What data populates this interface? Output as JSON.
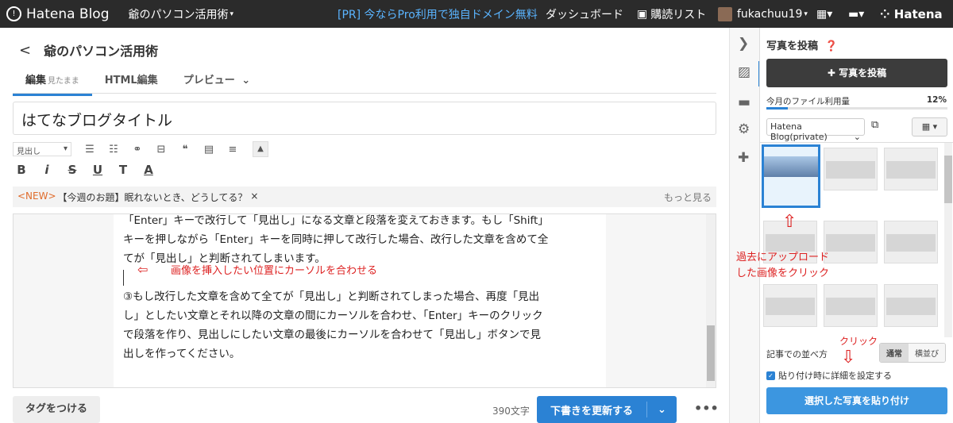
{
  "topbar": {
    "logo_text": "Hatena Blog",
    "blog_name": "爺のパソコン活用術",
    "pr_text": "[PR] 今ならPro利用で独自ドメイン無料",
    "dashboard": "ダッシュボード",
    "subscriptions": "購読リスト",
    "username": "fukachuu19",
    "hatena": "Hatena"
  },
  "editor_header": {
    "back": "<",
    "blog_title": "爺のパソコン活用術"
  },
  "tabs": [
    {
      "label": "編集",
      "sub": "見たまま"
    },
    {
      "label": "HTML編集",
      "sub": ""
    },
    {
      "label": "プレビュー",
      "sub": ""
    }
  ],
  "title_value": "はてなブログタイトル",
  "toolbar": {
    "heading_select": "見出し",
    "buttons2": [
      "B",
      "i",
      "S",
      "U",
      "T",
      "A"
    ]
  },
  "notice": {
    "new_tag": "<NEW>",
    "text": "【今週のお題】眠れないとき、どうしてる？",
    "close": "×",
    "more": "もっと見る"
  },
  "body": {
    "lines": [
      "「Enter」キーで改行して「見出し」になる文章と段落を変えておきます。もし「Shift」",
      "キーを押しながら「Enter」キーを同時に押して改行した場合、改行した文章を含めて全",
      "てが「見出し」と判断されてしまいます。"
    ],
    "annotation": "画像を挿入したい位置にカーソルを合わせる",
    "lines2": [
      "③もし改行した文章を含めて全てが「見出し」と判断されてしまった場合、再度「見出",
      "し」としたい文章とそれ以降の文章の間にカーソルを合わせ、「Enter」キーのクリック",
      "で段落を作り、見出しにしたい文章の最後にカーソルを合わせて「見出し」ボタンで見",
      "出しを作ってください。"
    ]
  },
  "bottom": {
    "tag_button": "タグをつける",
    "char_count": "390文字",
    "save_button": "下書きを更新する",
    "more": "•••"
  },
  "panel": {
    "title": "写真を投稿",
    "post_button": "写真を投稿",
    "usage_label": "今月のファイル利用量",
    "usage_value": "12%",
    "usage_fraction": 0.12,
    "album": "Hatena Blog(private)",
    "annotation_lines": [
      "過去にアップロード",
      "した画像をクリック"
    ],
    "sort_label": "記事での並べ方",
    "sort_options": [
      "通常",
      "横並び"
    ],
    "click_annotation": "クリック",
    "checkbox_label": "貼り付け時に詳細を設定する",
    "paste_button": "選択した写真を貼り付け"
  }
}
